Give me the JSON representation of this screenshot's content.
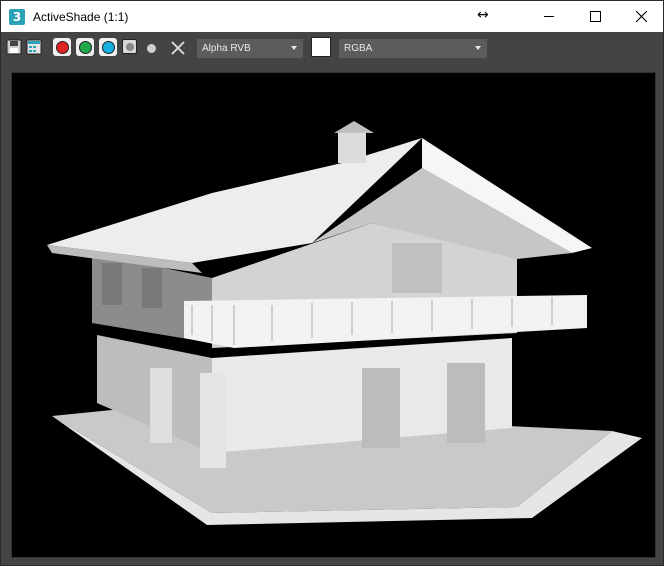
{
  "titlebar": {
    "app_icon_glyph": "3",
    "title": "ActiveShade (1:1)",
    "resize_glyph": "↔"
  },
  "toolbar": {
    "save_icon": "save-icon",
    "clone_icon": "clone-window-icon",
    "channels": [
      "red",
      "green",
      "blue",
      "alpha"
    ],
    "channel_colors": {
      "red": "#e02424",
      "green": "#1fa84a",
      "blue": "#18b0e0"
    },
    "channel_dropdown": "Alpha RVB",
    "display_dropdown": "RGBA",
    "background_color": "#ffffff"
  },
  "viewport": {
    "content": "rendered-house-icon",
    "background": "#000000"
  }
}
